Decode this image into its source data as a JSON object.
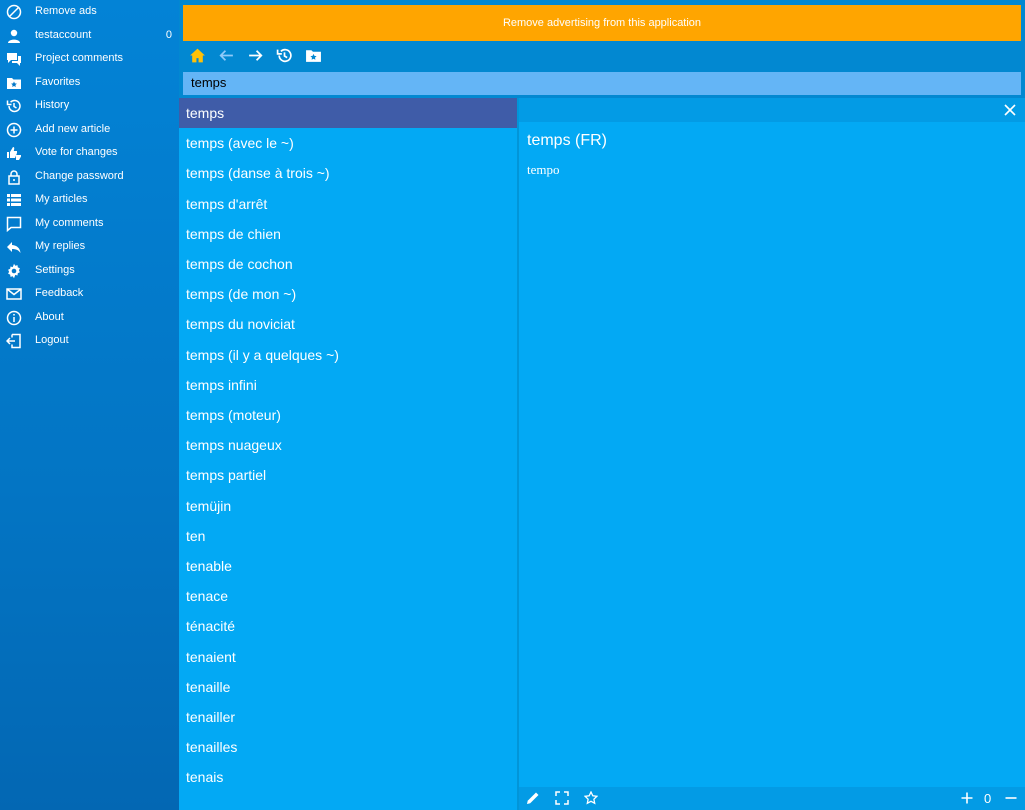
{
  "sidebar": {
    "items": [
      {
        "label": "Remove ads",
        "icon": "block-icon"
      },
      {
        "label": "testaccount",
        "icon": "user-icon",
        "count": "0"
      },
      {
        "label": "Project comments",
        "icon": "comments-icon"
      },
      {
        "label": "Favorites",
        "icon": "folder-star-icon"
      },
      {
        "label": "History",
        "icon": "history-icon"
      },
      {
        "label": "Add new article",
        "icon": "plus-circle-icon"
      },
      {
        "label": "Vote for changes",
        "icon": "thumbs-icon"
      },
      {
        "label": "Change password",
        "icon": "lock-icon"
      },
      {
        "label": "My articles",
        "icon": "list-icon"
      },
      {
        "label": "My comments",
        "icon": "comment-icon"
      },
      {
        "label": "My replies",
        "icon": "reply-icon"
      },
      {
        "label": "Settings",
        "icon": "gear-icon"
      },
      {
        "label": "Feedback",
        "icon": "mail-icon"
      },
      {
        "label": "About",
        "icon": "info-icon"
      },
      {
        "label": "Logout",
        "icon": "logout-icon"
      }
    ]
  },
  "ad_banner": {
    "text": "Remove advertising from this application"
  },
  "search": {
    "value": "temps"
  },
  "word_list": [
    "temps",
    "temps (avec le ~)",
    "temps (danse à trois ~)",
    "temps d'arrêt",
    "temps de chien",
    "temps de cochon",
    "temps (de mon ~)",
    "temps du noviciat",
    "temps (il y a quelques ~)",
    "temps infini",
    "temps (moteur)",
    "temps nuageux",
    "temps partiel",
    "temüjin",
    "ten",
    "tenable",
    "tenace",
    "ténacité",
    "tenaient",
    "tenaille",
    "tenailler",
    "tenailles",
    "tenais"
  ],
  "article": {
    "title": "temps (FR)",
    "body": "tempo",
    "zoom": "0"
  },
  "colors": {
    "accent": "#ffa500",
    "list_bg": "#03a9f4",
    "selected": "#3f5ca8",
    "home_icon": "#ffc107"
  }
}
